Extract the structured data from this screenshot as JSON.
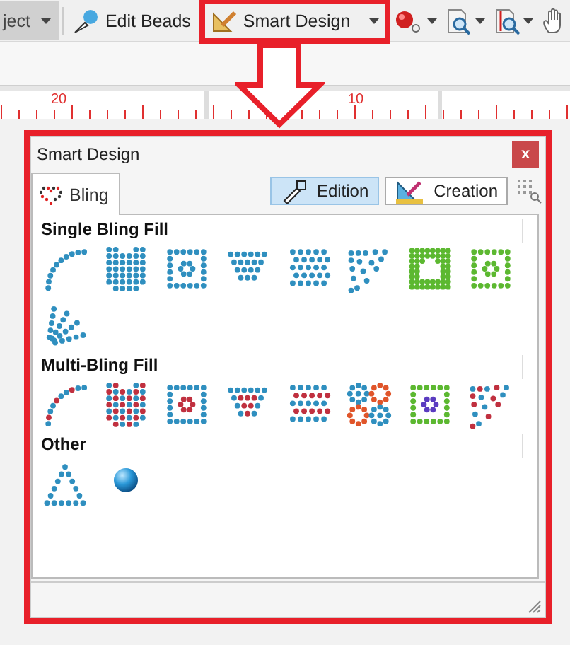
{
  "toolbar": {
    "cut_button": "ject",
    "edit_beads": "Edit Beads",
    "smart_design": {
      "label": "Smart Design",
      "highlighted": true
    }
  },
  "ruler": {
    "labels": [
      "20",
      "10"
    ]
  },
  "panel": {
    "title": "Smart Design",
    "close": "x",
    "highlighted": true,
    "tab": {
      "label": "Bling",
      "selected": true
    },
    "mode_buttons": [
      {
        "label": "Edition",
        "selected": true
      },
      {
        "label": "Creation",
        "selected": false
      }
    ],
    "sections": [
      {
        "title": "Single Bling Fill",
        "items": [
          {
            "kind": "arc"
          },
          {
            "kind": "shield"
          },
          {
            "kind": "square-ring"
          },
          {
            "kind": "trapezoid"
          },
          {
            "kind": "grid"
          },
          {
            "kind": "scatter"
          },
          {
            "kind": "star-fill"
          },
          {
            "kind": "green-ring"
          },
          {
            "kind": "rays"
          }
        ]
      },
      {
        "title": "Multi-Bling Fill",
        "items": [
          {
            "kind": "arc-multi"
          },
          {
            "kind": "shield-multi"
          },
          {
            "kind": "square-ring-multi"
          },
          {
            "kind": "trapezoid-multi"
          },
          {
            "kind": "grid-multi"
          },
          {
            "kind": "diamonds"
          },
          {
            "kind": "purple-ring"
          },
          {
            "kind": "scatter-multi"
          }
        ]
      },
      {
        "title": "Other",
        "items": [
          {
            "kind": "triangle"
          },
          {
            "kind": "sphere"
          }
        ]
      }
    ]
  }
}
